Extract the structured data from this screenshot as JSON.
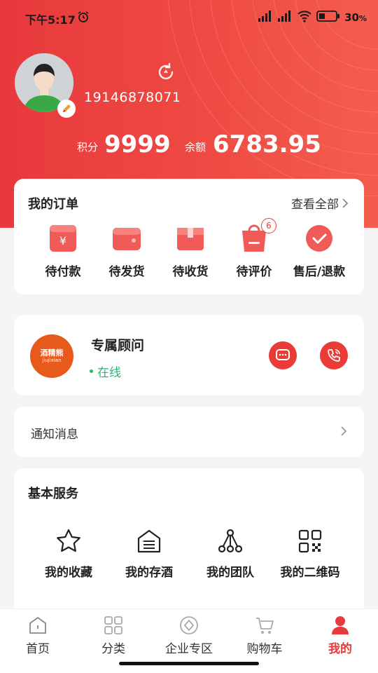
{
  "status_bar": {
    "time": "下午5:17",
    "battery": "30",
    "battery_unit": "%"
  },
  "profile": {
    "phone": "19146878071",
    "points_label": "积分",
    "points_value": "9999",
    "balance_label": "余额",
    "balance_value": "6783.95"
  },
  "orders": {
    "title": "我的订单",
    "view_all": "查看全部",
    "items": [
      {
        "label": "待付款",
        "icon": "pending-payment-icon"
      },
      {
        "label": "待发货",
        "icon": "pending-shipment-icon"
      },
      {
        "label": "待收货",
        "icon": "pending-receipt-icon"
      },
      {
        "label": "待评价",
        "icon": "pending-review-icon",
        "badge": "6"
      },
      {
        "label": "售后/退款",
        "icon": "after-sales-icon"
      }
    ]
  },
  "advisor": {
    "logo_text": "酒精熊",
    "logo_subtext": "jiujixian",
    "title": "专属顾问",
    "status": "在线"
  },
  "notice": {
    "label": "通知消息"
  },
  "services": {
    "title": "基本服务",
    "items": [
      {
        "label": "我的收藏",
        "icon": "star-icon"
      },
      {
        "label": "我的存酒",
        "icon": "wine-storage-icon"
      },
      {
        "label": "我的团队",
        "icon": "team-icon"
      },
      {
        "label": "我的二维码",
        "icon": "qrcode-icon"
      }
    ]
  },
  "tabbar": {
    "items": [
      {
        "label": "首页",
        "icon": "home-icon"
      },
      {
        "label": "分类",
        "icon": "category-icon"
      },
      {
        "label": "企业专区",
        "icon": "enterprise-icon"
      },
      {
        "label": "购物车",
        "icon": "cart-icon"
      },
      {
        "label": "我的",
        "icon": "profile-icon",
        "active": true
      }
    ]
  },
  "colors": {
    "accent": "#e8393c",
    "online": "#2bb673",
    "advisor_logo": "#e85a1c"
  }
}
